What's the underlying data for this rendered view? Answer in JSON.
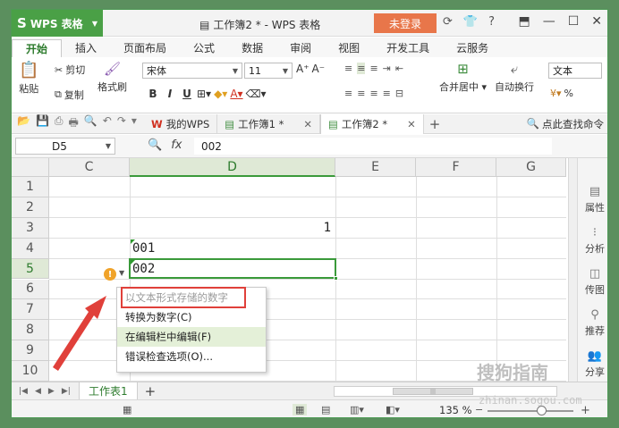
{
  "app": {
    "name": "WPS 表格",
    "logo": "S"
  },
  "window": {
    "doc_title": "工作簿2 * - WPS 表格",
    "login_label": "未登录"
  },
  "ribbon_tabs": [
    "开始",
    "插入",
    "页面布局",
    "公式",
    "数据",
    "审阅",
    "视图",
    "开发工具",
    "云服务"
  ],
  "ribbon": {
    "paste": "粘贴",
    "cut": "剪切",
    "copy": "复制",
    "format_painter": "格式刷",
    "font_name": "宋体",
    "font_size": "11",
    "merge_center": "合并居中",
    "wrap_text": "自动换行",
    "number_format": "文本",
    "percent": "%"
  },
  "doc_tabs": [
    {
      "label": "我的WPS"
    },
    {
      "label": "工作簿1 *"
    },
    {
      "label": "工作簿2 *"
    }
  ],
  "find_label": "点此查找命令",
  "formula_bar": {
    "cell_ref": "D5",
    "fx": "fx",
    "value": "002"
  },
  "columns": [
    "C",
    "D",
    "E",
    "F",
    "G"
  ],
  "rows": [
    "1",
    "2",
    "3",
    "4",
    "5",
    "6",
    "7",
    "8",
    "9",
    "10"
  ],
  "cells": {
    "D3": "1",
    "D4": "001",
    "D5": "002"
  },
  "context_menu": {
    "items": [
      {
        "label": "以文本形式存储的数字",
        "state": "disabled"
      },
      {
        "label": "转换为数字(C)",
        "state": "normal"
      },
      {
        "label": "在编辑栏中编辑(F)",
        "state": "hover"
      },
      {
        "label": "错误检查选项(O)...",
        "state": "normal"
      }
    ]
  },
  "side_panel": [
    "属性",
    "分析",
    "传图",
    "推荐",
    "分享"
  ],
  "sheet_tabs": [
    "工作表1"
  ],
  "status": {
    "zoom": "135 %"
  },
  "watermark": {
    "brand": "搜狗指南",
    "url": "zhinan.sogou.com"
  },
  "colors": {
    "accent_green": "#4aa046",
    "login_orange": "#e8764a",
    "highlight_red": "#e0403a"
  }
}
